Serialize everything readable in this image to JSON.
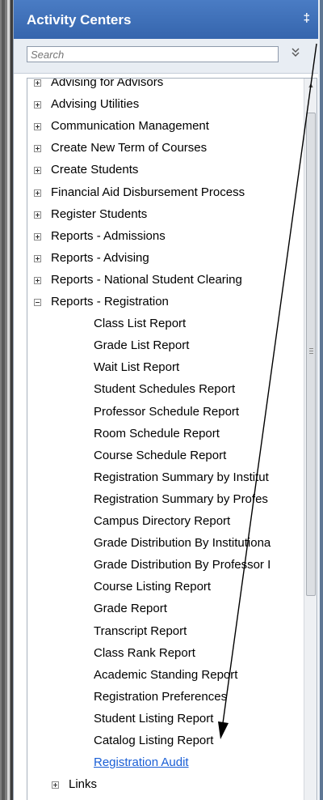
{
  "panel": {
    "title": "Activity Centers",
    "pin_glyph": "‡"
  },
  "search": {
    "placeholder": "Search",
    "chevron_icon": "double-chevron-down"
  },
  "tree": {
    "top_level": [
      {
        "label": "Advising for Advisors",
        "state": "collapsed"
      },
      {
        "label": "Advising Utilities",
        "state": "collapsed"
      },
      {
        "label": "Communication Management",
        "state": "collapsed"
      },
      {
        "label": "Create New Term of Courses",
        "state": "collapsed"
      },
      {
        "label": "Create Students",
        "state": "collapsed"
      },
      {
        "label": "Financial Aid Disbursement Process",
        "state": "collapsed"
      },
      {
        "label": "Register Students",
        "state": "collapsed"
      },
      {
        "label": "Reports - Admissions",
        "state": "collapsed"
      },
      {
        "label": "Reports - Advising",
        "state": "collapsed"
      },
      {
        "label": "Reports - National Student Clearing",
        "state": "collapsed"
      },
      {
        "label": "Reports - Registration",
        "state": "expanded"
      }
    ],
    "registration_children": [
      {
        "label": "Class List Report"
      },
      {
        "label": "Grade List Report"
      },
      {
        "label": "Wait List Report"
      },
      {
        "label": "Student Schedules Report"
      },
      {
        "label": "Professor Schedule Report"
      },
      {
        "label": "Room Schedule Report"
      },
      {
        "label": "Course Schedule Report"
      },
      {
        "label": "Registration Summary by Institut"
      },
      {
        "label": "Registration Summary by Profes"
      },
      {
        "label": "Campus Directory Report"
      },
      {
        "label": "Grade Distribution By Institutiona"
      },
      {
        "label": "Grade Distribution By Professor I"
      },
      {
        "label": "Course Listing Report"
      },
      {
        "label": "Grade Report"
      },
      {
        "label": "Transcript Report"
      },
      {
        "label": "Class Rank Report"
      },
      {
        "label": "Academic Standing Report"
      },
      {
        "label": "Registration Preferences"
      },
      {
        "label": "Student Listing Report"
      },
      {
        "label": "Catalog Listing Report"
      },
      {
        "label": "Registration Audit",
        "link": true
      }
    ],
    "after": {
      "label": "Links",
      "state": "collapsed"
    }
  },
  "colors": {
    "title_bar": "#3f6fb8",
    "link": "#1a5fd6",
    "annotation_arrow": "#000000"
  }
}
